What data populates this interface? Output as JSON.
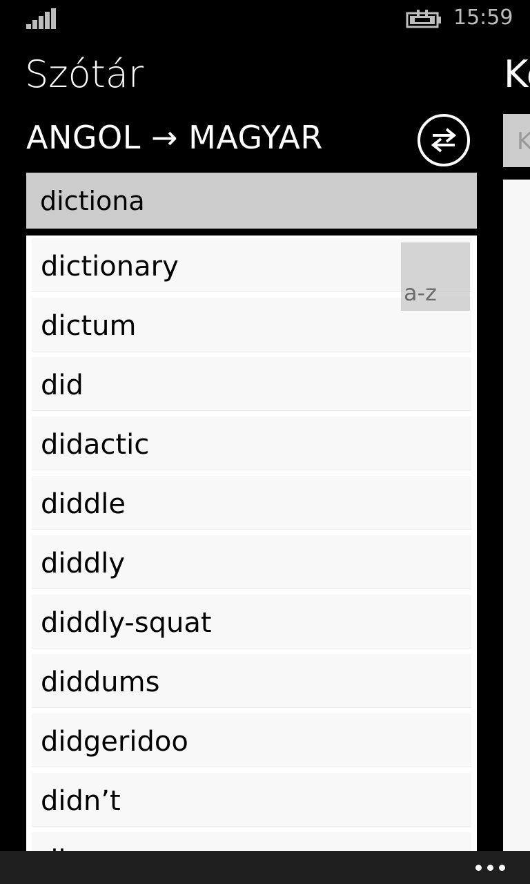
{
  "status_bar": {
    "time": "15:59",
    "signal_icon": "signal-bars-icon",
    "battery_icon": "battery-charging-icon"
  },
  "header": {
    "app_title": "Szótár",
    "next_pane_title": "Ke",
    "direction": "ANGOL → MAGYAR",
    "swap_icon": "swap-arrows-icon"
  },
  "search": {
    "value": "dictiona"
  },
  "peek_pane": {
    "input_placeholder": "K"
  },
  "word_list": {
    "items": [
      "dictionary",
      "dictum",
      "did",
      "didactic",
      "diddle",
      "diddly",
      "diddly-squat",
      "diddums",
      "didgeridoo",
      "didn’t",
      "di"
    ],
    "jump_label": "a-z"
  },
  "app_bar": {
    "more_icon": "more-ellipsis-icon"
  }
}
